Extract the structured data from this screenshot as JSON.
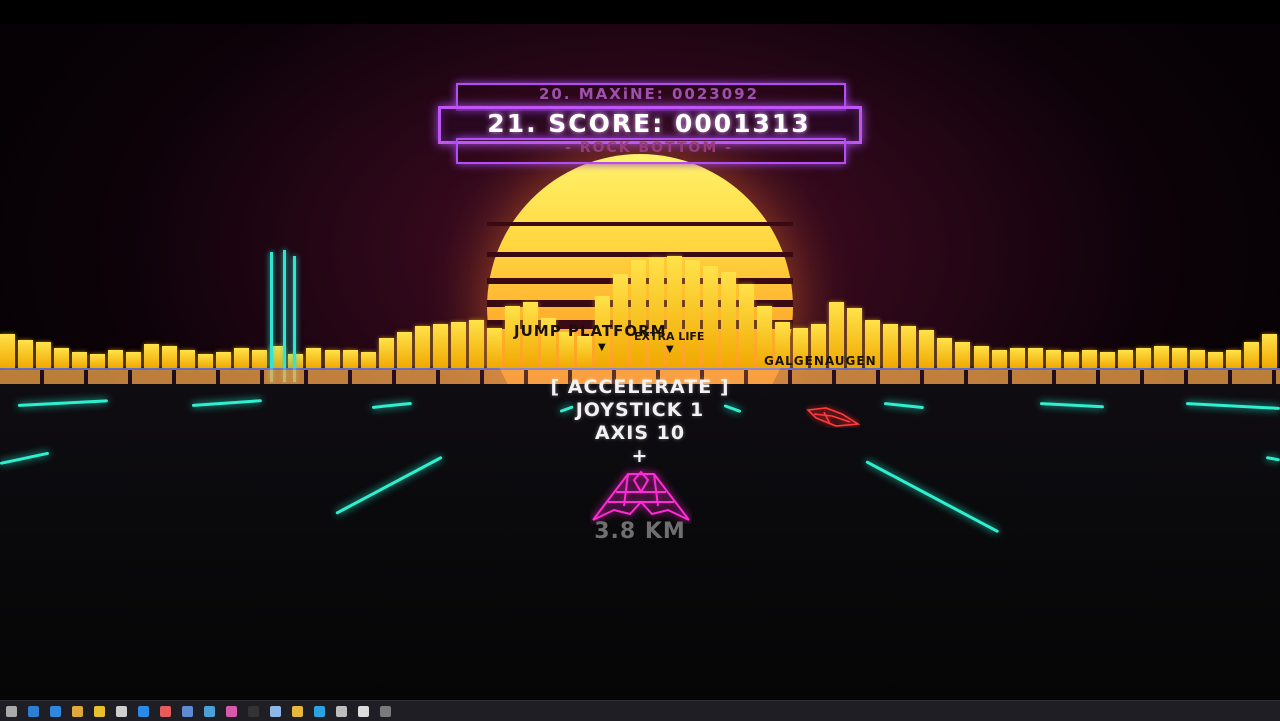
{
  "game": {
    "scoreboard": {
      "previous_entry": "20. MAXiNE: 0023092",
      "current_entry": "21. SCORE: 0001313",
      "rank_title": "- ROCK BOTTOM -"
    },
    "world_labels": {
      "jump_platform": "JUMP PLATFORM",
      "extra_life": "EXTRA LIFE",
      "galgenaugen": "GALGENAUGEN"
    },
    "control_prompt": {
      "action": "[ ACCELERATE ]",
      "device": "JOYSTICK 1",
      "axis": "AXIS 10",
      "direction": "+"
    },
    "distance": "3.8 KM",
    "colors": {
      "scoreboard_frame": "#c055f5",
      "sun_top": "#fff36a",
      "sun_bottom": "#ff3a1c",
      "equalizer": "#ffd640",
      "lane_lines": "#2ef0d0",
      "player_ship": "#ff2bd6",
      "enemy_ship": "#ff3b3b"
    }
  },
  "taskbar": {
    "icons": [
      "start-icon",
      "search-icon",
      "edge-icon",
      "store-icon",
      "chrome-icon",
      "mail-icon",
      "vscode-icon",
      "paint-icon",
      "steam-icon",
      "app-icon",
      "browser-icon",
      "terminal-icon",
      "calculator-icon",
      "folder-icon",
      "telegram-icon",
      "chat-icon",
      "unity-icon",
      "game-icon"
    ]
  }
}
